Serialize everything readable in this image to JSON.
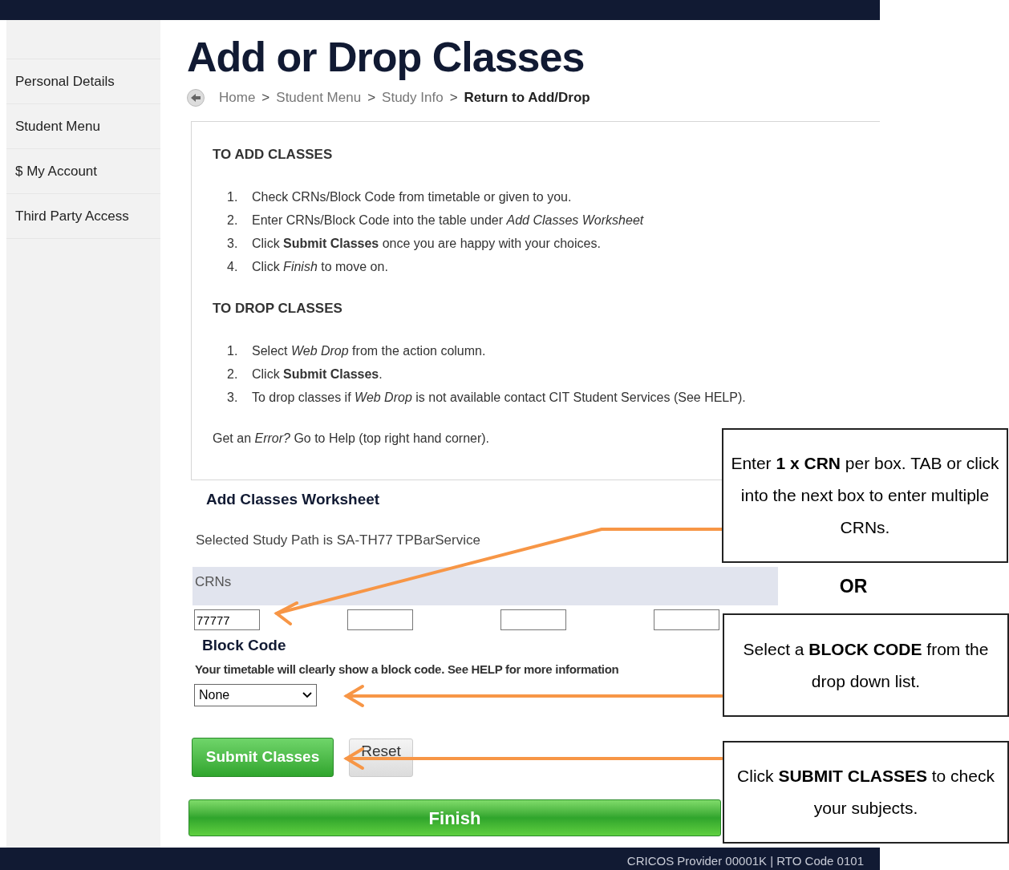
{
  "sidebar": {
    "items": [
      {
        "label": "Personal Details"
      },
      {
        "label": "Student Menu"
      },
      {
        "label": "$ My Account"
      },
      {
        "label": "Third Party Access"
      }
    ]
  },
  "title": "Add or Drop Classes",
  "breadcrumb": [
    {
      "label": "Home",
      "current": false
    },
    {
      "label": "Student Menu",
      "current": false
    },
    {
      "label": "Study Info",
      "current": false
    },
    {
      "label": "Return to Add/Drop",
      "current": true
    }
  ],
  "separator": ">",
  "instructions": {
    "sections": [
      {
        "heading": "TO ADD CLASSES",
        "steps": [
          {
            "number": "1.",
            "text": "Check CRNs/Block Code from timetable or given to you."
          },
          {
            "number": "2.",
            "text": "Enter CRNs/Block Code into the table under *Add Classes Worksheet*"
          },
          {
            "number": "3.",
            "text": "Click **Submit Classes** once you are happy with your choices."
          },
          {
            "number": "4.",
            "text": "Click *Finish* to move on."
          }
        ]
      },
      {
        "heading": "TO DROP CLASSES",
        "steps": [
          {
            "number": "1.",
            "text": "Select *Web Drop* from the action column."
          },
          {
            "number": "2.",
            "text": "Click **Submit Classes**."
          },
          {
            "number": "3.",
            "text": "To drop classes if *Web Drop* is not available contact CIT Student Services (See HELP)."
          }
        ]
      }
    ],
    "note": "Get an *Error?* Go to Help (top right hand corner)."
  },
  "worksheet": {
    "heading": "Add Classes Worksheet",
    "study_path": "Selected Study Path is SA-TH77 TPBarService",
    "crn_label": "CRNs",
    "crn_fields": [
      {
        "kind": "input",
        "value": "77777"
      },
      {
        "kind": "input"
      },
      {
        "kind": "input"
      },
      {
        "kind": "input"
      }
    ],
    "block_code_heading": "Block Code",
    "block_code_hint": "Your timetable will clearly show a block code. See HELP for more information",
    "block_code_value": "None"
  },
  "buttons": {
    "submit": "Submit Classes",
    "reset": "Reset",
    "finish": "Finish"
  },
  "footer": "CRICOS Provider 00001K | RTO Code 0101",
  "callouts": [
    {
      "kind": "box",
      "text": "Enter **1 x CRN** per box. TAB or click into the next box to enter multiple CRNs."
    },
    {
      "kind": "label",
      "text": "OR"
    },
    {
      "kind": "box",
      "text": "Select a **BLOCK CODE** from the drop down list."
    },
    {
      "kind": "box",
      "text": "Click **SUBMIT CLASSES** to check your subjects."
    }
  ]
}
